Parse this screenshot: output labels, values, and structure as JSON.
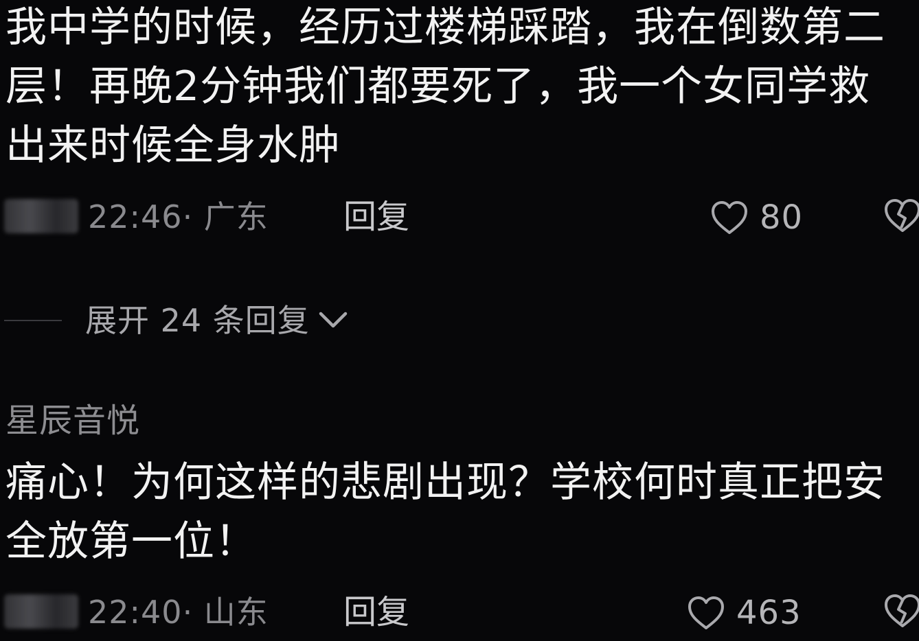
{
  "comments": [
    {
      "text": "我中学的时候，经历过楼梯踩踏，我在倒数第二层！再晚2分钟我们都要死了，我一个女同学救出来时候全身水肿",
      "timestamp": "22:46· 广东",
      "reply_label": "回复",
      "likes": "80",
      "expand_label": "展开 24 条回复"
    },
    {
      "username": "星辰音悦",
      "text": "痛心！为何这样的悲剧出现？学校何时真正把安全放第一位！",
      "timestamp": "22:40· 山东",
      "reply_label": "回复",
      "likes": "463"
    }
  ],
  "icons": {
    "like": "heart-outline-icon",
    "dislike": "broken-heart-icon",
    "expand": "chevron-down-icon"
  },
  "colors": {
    "background": "#070709",
    "primary_text": "#f2f2f2",
    "secondary_text": "#8a8a8e"
  }
}
